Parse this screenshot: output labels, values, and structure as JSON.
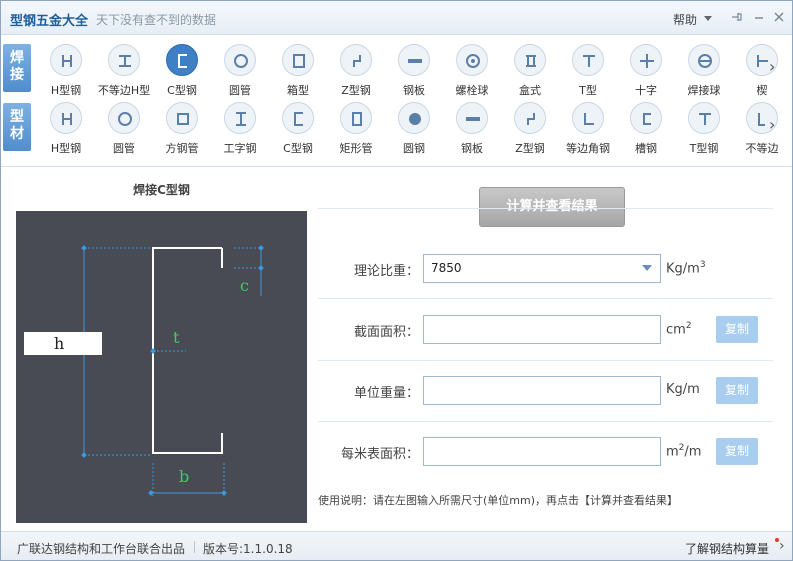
{
  "titlebar": {
    "title": "型钢五金大全",
    "slogan": "天下没有查不到的数据",
    "help_label": "帮助"
  },
  "toolbar": {
    "welded_tag": [
      "焊",
      "接"
    ],
    "profile_tag": [
      "型",
      "材"
    ],
    "welded_items": [
      {
        "label": "H型钢",
        "icon": "h-beam-icon"
      },
      {
        "label": "不等边H型",
        "icon": "unequal-h-icon"
      },
      {
        "label": "C型钢",
        "icon": "c-channel-icon",
        "active": true
      },
      {
        "label": "圆管",
        "icon": "round-tube-icon"
      },
      {
        "label": "箱型",
        "icon": "box-section-icon"
      },
      {
        "label": "Z型钢",
        "icon": "z-section-icon"
      },
      {
        "label": "钢板",
        "icon": "steel-plate-icon"
      },
      {
        "label": "螺栓球",
        "icon": "bolt-ball-icon"
      },
      {
        "label": "盒式",
        "icon": "box-type-icon"
      },
      {
        "label": "T型",
        "icon": "t-section-icon"
      },
      {
        "label": "十字",
        "icon": "cross-section-icon"
      },
      {
        "label": "焊接球",
        "icon": "welded-ball-icon"
      },
      {
        "label": "楔",
        "icon": "wedge-icon"
      }
    ],
    "profile_items": [
      {
        "label": "H型钢",
        "icon": "h-beam-icon"
      },
      {
        "label": "圆管",
        "icon": "round-tube-icon"
      },
      {
        "label": "方钢管",
        "icon": "square-tube-icon"
      },
      {
        "label": "工字钢",
        "icon": "i-beam-icon"
      },
      {
        "label": "C型钢",
        "icon": "c-channel-icon"
      },
      {
        "label": "矩形管",
        "icon": "rect-tube-icon"
      },
      {
        "label": "圆钢",
        "icon": "round-bar-icon"
      },
      {
        "label": "钢板",
        "icon": "steel-plate-icon"
      },
      {
        "label": "Z型钢",
        "icon": "z-section-icon"
      },
      {
        "label": "等边角钢",
        "icon": "equal-angle-icon"
      },
      {
        "label": "槽钢",
        "icon": "channel-icon"
      },
      {
        "label": "T型钢",
        "icon": "t-section-icon"
      },
      {
        "label": "不等边",
        "icon": "unequal-angle-icon"
      }
    ]
  },
  "left_panel": {
    "title": "焊接C型钢",
    "dims": {
      "h": "h",
      "t": "t",
      "c": "c",
      "b": "b"
    }
  },
  "right_panel": {
    "calc_button": "计算并查看结果",
    "fields": [
      {
        "label": "理论比重：",
        "value": "7850",
        "unit_base": "Kg/m",
        "unit_sup": "3",
        "copy": ""
      },
      {
        "label": "截面面积：",
        "value": "",
        "unit_base": "cm",
        "unit_sup": "2",
        "copy": "复制"
      },
      {
        "label": "单位重量：",
        "value": "",
        "unit_base": "Kg/m",
        "unit_sup": "",
        "copy": "复制"
      },
      {
        "label": "每米表面积：",
        "value": "",
        "unit_base": "m",
        "unit_sup": "2",
        "unit_tail": "/m",
        "copy": "复制"
      }
    ],
    "usage": "使用说明：请在左图输入所需尺寸(单位mm)，再点击【计算并查看结果】"
  },
  "statusbar": {
    "credit": "广联达钢结构和工作台联合出品",
    "version": "版本号:1.1.0.18",
    "link": "了解钢结构算量"
  }
}
